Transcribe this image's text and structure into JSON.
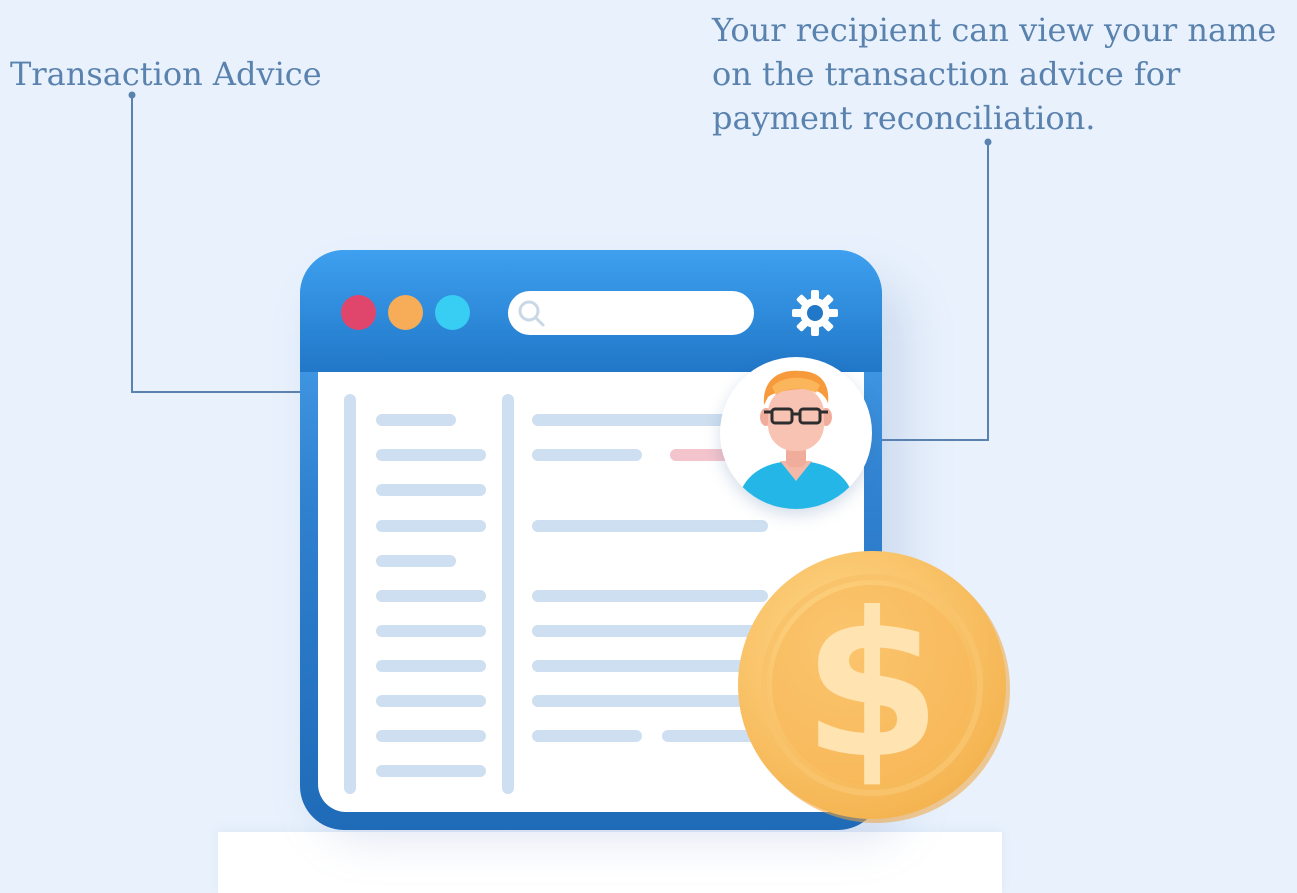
{
  "labels": {
    "left": "Transaction Advice",
    "right_lines": [
      "Your recipient can view your name",
      "on the transaction advice for",
      "payment reconciliation."
    ]
  },
  "window": {
    "controls": [
      "red-dot",
      "orange-dot",
      "cyan-dot"
    ],
    "icons": [
      "search-icon",
      "gear-icon",
      "avatar-icon",
      "dollar-coin-icon"
    ]
  },
  "colors": {
    "background": "#e8f1fc",
    "caption": "#5a82ae",
    "window_frame": "#2f80cf",
    "dot_red": "#e0466c",
    "dot_orange": "#f7ac57",
    "dot_cyan": "#38cdf2",
    "placeholder_line": "#cddff0",
    "coin": "#f8c46c"
  }
}
